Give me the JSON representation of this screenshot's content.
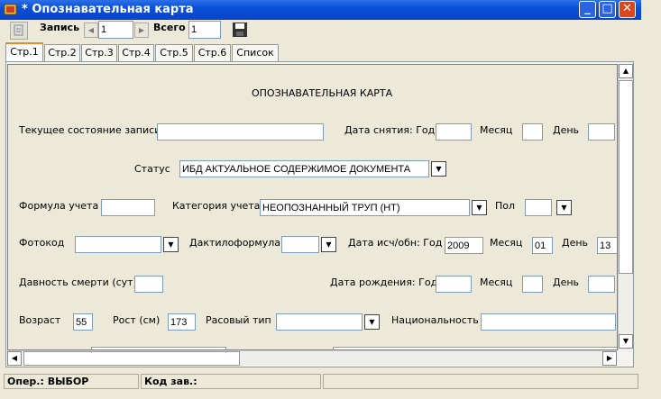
{
  "window": {
    "title": "* Опознавательная карта"
  },
  "toolbar": {
    "record_label": "Запись",
    "record_value": "1",
    "total_label": "Всего",
    "total_value": "1"
  },
  "tabs": [
    "Стр.1",
    "Стр.2",
    "Стр.3",
    "Стр.4",
    "Стр.5",
    "Стр.6",
    "Список"
  ],
  "active_tab": "Стр.1",
  "form": {
    "heading": "ОПОЗНАВАТЕЛЬНАЯ КАРТА",
    "current_state_label": "Текущее состояние записи",
    "current_state_value": "",
    "removal_date_label": "Дата снятия: Год",
    "month_label": "Месяц",
    "day_label": "День",
    "status_label": "Статус",
    "status_value": "ИБД АКТУАЛЬНОЕ СОДЕРЖИМОЕ ДОКУМЕНТА",
    "account_formula_label": "Формула учета",
    "account_category_label": "Категория учета",
    "account_category_value": "НЕОПОЗНАННЫЙ ТРУП (НТ)",
    "sex_label": "Пол",
    "photocode_label": "Фотокод",
    "dactyl_formula_label": "Дактилоформула",
    "entry_date_label": "Дата исч/обн: Год",
    "entry_year_value": "2009",
    "entry_month_label": "Месяц",
    "entry_month_value": "01",
    "entry_day_label": "День",
    "entry_day_value": "13",
    "death_age_label": "Давность смерти (сут)",
    "birth_date_label": "Дата рождения: Год",
    "birth_month_label": "Месяц",
    "birth_day_label": "День",
    "age_label": "Возраст",
    "age_value": "55",
    "height_label": "Рост (см)",
    "height_value": "173",
    "race_label": "Расовый тип",
    "nationality_label": "Национальность"
  },
  "statusbar": {
    "operation": "Опер.: ВЫБОР",
    "code": "Код зав.:"
  },
  "colors": {
    "titlebar": "#0a4fd8",
    "active_tab_accent": "#e68b2c",
    "window_bg": "#ece9d8"
  }
}
